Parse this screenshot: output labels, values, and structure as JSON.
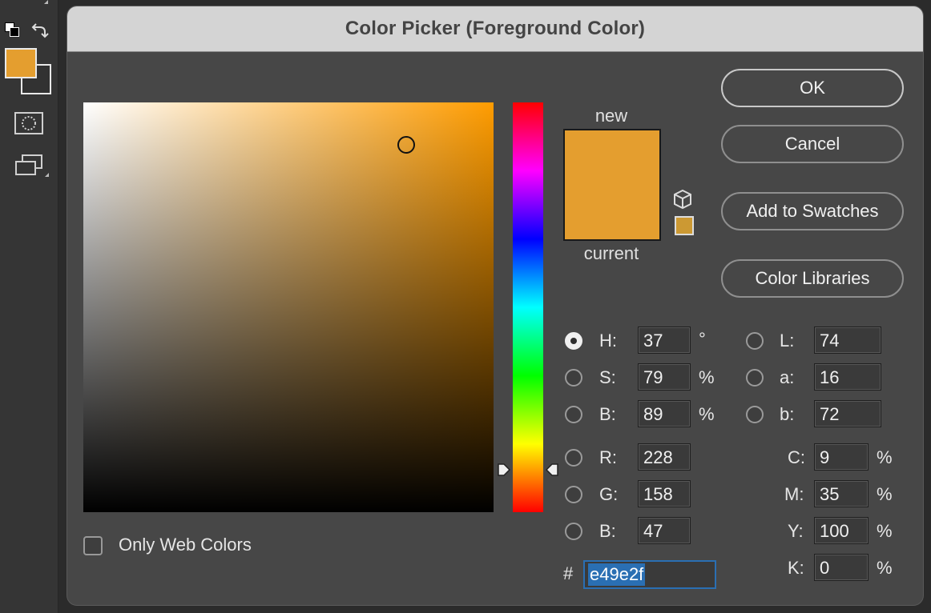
{
  "dialog": {
    "title": "Color Picker (Foreground Color)",
    "preview_new_label": "new",
    "preview_current_label": "current",
    "new_color": "#e49e2f",
    "current_color": "#e49e2f",
    "websafe_color": "#cc9933",
    "field_hue_color": "#ff9c00"
  },
  "buttons": {
    "ok": "OK",
    "cancel": "Cancel",
    "add_to_swatches": "Add to Swatches",
    "color_libraries": "Color Libraries"
  },
  "hsb": {
    "h_label": "H:",
    "h_value": "37",
    "h_unit": "°",
    "s_label": "S:",
    "s_value": "79",
    "s_unit": "%",
    "b_label": "B:",
    "b_value": "89",
    "b_unit": "%",
    "selected": "H"
  },
  "rgb": {
    "r_label": "R:",
    "r_value": "228",
    "g_label": "G:",
    "g_value": "158",
    "b_label": "B:",
    "b_value": "47"
  },
  "lab": {
    "l_label": "L:",
    "l_value": "74",
    "a_label": "a:",
    "a_value": "16",
    "b_label": "b:",
    "b_value": "72"
  },
  "cmyk": {
    "c_label": "C:",
    "c_value": "9",
    "c_unit": "%",
    "m_label": "M:",
    "m_value": "35",
    "m_unit": "%",
    "y_label": "Y:",
    "y_value": "100",
    "y_unit": "%",
    "k_label": "K:",
    "k_value": "0",
    "k_unit": "%"
  },
  "hex": {
    "hash": "#",
    "value": "e49e2f"
  },
  "only_web_colors": {
    "label": "Only Web Colors",
    "checked": false
  },
  "toolbar": {
    "foreground_color": "#e49e2f",
    "background_color": "#323232",
    "icons": [
      "default-colors-icon",
      "swap-colors-icon",
      "quick-mask-icon",
      "screen-mode-icon"
    ]
  }
}
